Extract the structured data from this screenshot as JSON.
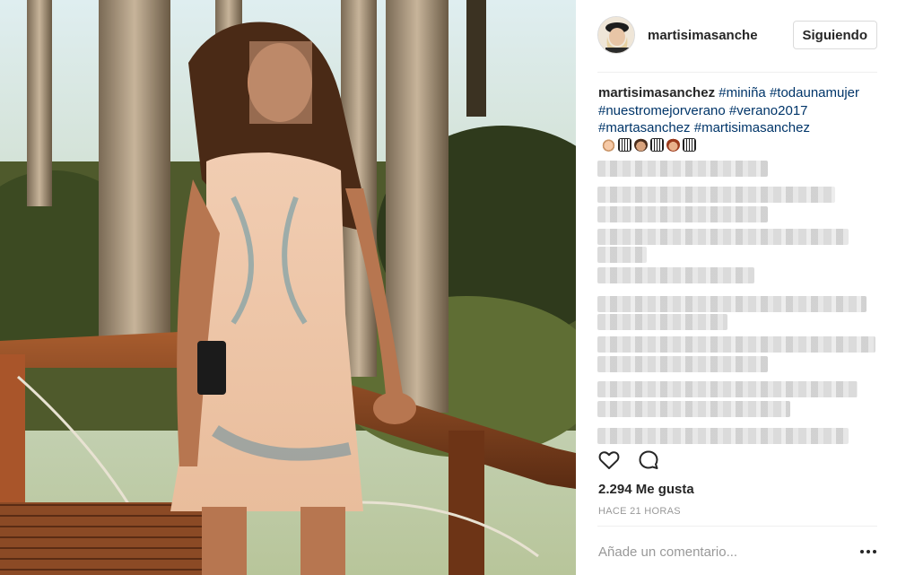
{
  "post": {
    "photo_alt": "photo",
    "username": "martisimasanche",
    "follow_label": "Siguiendo",
    "caption": {
      "username": "martisimasanchez",
      "hashtags": [
        "#miniña",
        "#todaunamujer",
        "#nuestromejorverano",
        "#verano2017",
        "#martasanchez",
        "#martisimasanchez"
      ]
    },
    "likes": "2.294 Me gusta",
    "timestamp": "HACE 21 HORAS",
    "comment_placeholder": "Añade un comentario..."
  },
  "icons": {
    "like": "heart-icon",
    "comment": "comment-icon",
    "more": "more-options-icon"
  }
}
